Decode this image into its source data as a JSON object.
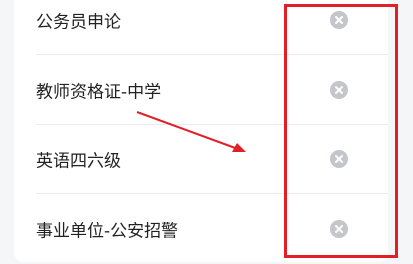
{
  "list": {
    "items": [
      {
        "label": "公务员申论",
        "remove_icon": "close-circle-icon"
      },
      {
        "label": "教师资格证-中学",
        "remove_icon": "close-circle-icon"
      },
      {
        "label": "英语四六级",
        "remove_icon": "close-circle-icon"
      },
      {
        "label": "事业单位-公安招警",
        "remove_icon": "close-circle-icon"
      }
    ],
    "remove_icon_color": "#c4c6cc"
  },
  "annotation": {
    "color": "#e21f26"
  }
}
